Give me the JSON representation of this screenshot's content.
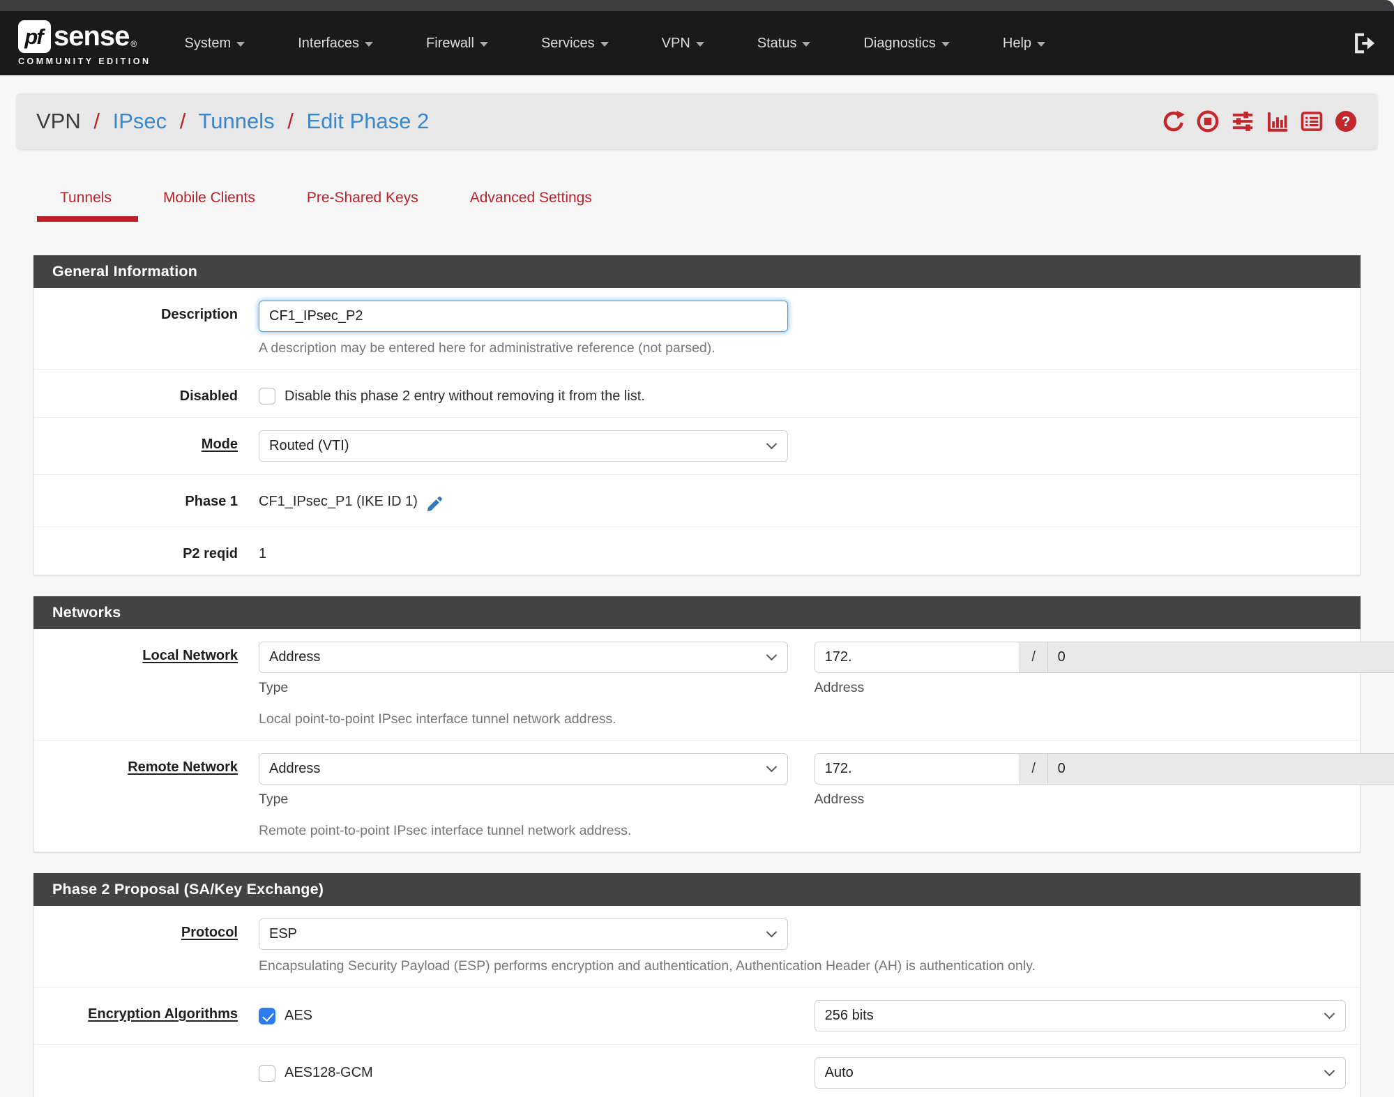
{
  "colors": {
    "accent-red": "#bb2129",
    "link-blue": "#3787c9",
    "edit-blue": "#337ab7",
    "check-blue": "#2e7cf0",
    "header-bg": "#434343",
    "navbar-bg": "#1a1a1a"
  },
  "navbar": {
    "logo": {
      "pf": "pf",
      "sense": "sense",
      "trademark": "®",
      "subtitle": "COMMUNITY EDITION"
    },
    "items": [
      {
        "label": "System"
      },
      {
        "label": "Interfaces"
      },
      {
        "label": "Firewall"
      },
      {
        "label": "Services"
      },
      {
        "label": "VPN"
      },
      {
        "label": "Status"
      },
      {
        "label": "Diagnostics"
      },
      {
        "label": "Help"
      }
    ]
  },
  "breadcrumb": {
    "section": "VPN",
    "separator": "/",
    "links": [
      {
        "label": "IPsec"
      },
      {
        "label": "Tunnels"
      },
      {
        "label": "Edit Phase 2"
      }
    ],
    "action_icons": [
      {
        "name": "refresh-icon"
      },
      {
        "name": "stop-circle-icon"
      },
      {
        "name": "sliders-icon"
      },
      {
        "name": "bar-chart-icon"
      },
      {
        "name": "log-list-icon"
      },
      {
        "name": "help-icon"
      }
    ]
  },
  "tabs": [
    {
      "label": "Tunnels",
      "active": true
    },
    {
      "label": "Mobile Clients",
      "active": false
    },
    {
      "label": "Pre-Shared Keys",
      "active": false
    },
    {
      "label": "Advanced Settings",
      "active": false
    }
  ],
  "general": {
    "title": "General Information",
    "description": {
      "label": "Description",
      "value": "CF1_IPsec_P2",
      "help": "A description may be entered here for administrative reference (not parsed)."
    },
    "disabled": {
      "label": "Disabled",
      "checked": false,
      "checkbox_label": "Disable this phase 2 entry without removing it from the list."
    },
    "mode": {
      "label": "Mode",
      "value": "Routed (VTI)"
    },
    "phase1": {
      "label": "Phase 1",
      "value": "CF1_IPsec_P1 (IKE ID 1)"
    },
    "p2reqid": {
      "label": "P2 reqid",
      "value": "1"
    }
  },
  "networks": {
    "title": "Networks",
    "local": {
      "label": "Local Network",
      "type_value": "Address",
      "type_sub": "Type",
      "address_value": "172.",
      "address_sub": "Address",
      "mask_separator": "/",
      "mask_value": "0",
      "help": "Local point-to-point IPsec interface tunnel network address."
    },
    "remote": {
      "label": "Remote Network",
      "type_value": "Address",
      "type_sub": "Type",
      "address_value": "172.",
      "address_sub": "Address",
      "mask_separator": "/",
      "mask_value": "0",
      "help": "Remote point-to-point IPsec interface tunnel network address."
    }
  },
  "proposal": {
    "title": "Phase 2 Proposal (SA/Key Exchange)",
    "protocol": {
      "label": "Protocol",
      "value": "ESP",
      "help": "Encapsulating Security Payload (ESP) performs encryption and authentication, Authentication Header (AH) is authentication only."
    },
    "encryption": {
      "label": "Encryption Algorithms",
      "rows": [
        {
          "name": "AES",
          "checked": true,
          "bits": "256 bits"
        },
        {
          "name": "AES128-GCM",
          "checked": false,
          "bits": "Auto"
        }
      ]
    }
  }
}
